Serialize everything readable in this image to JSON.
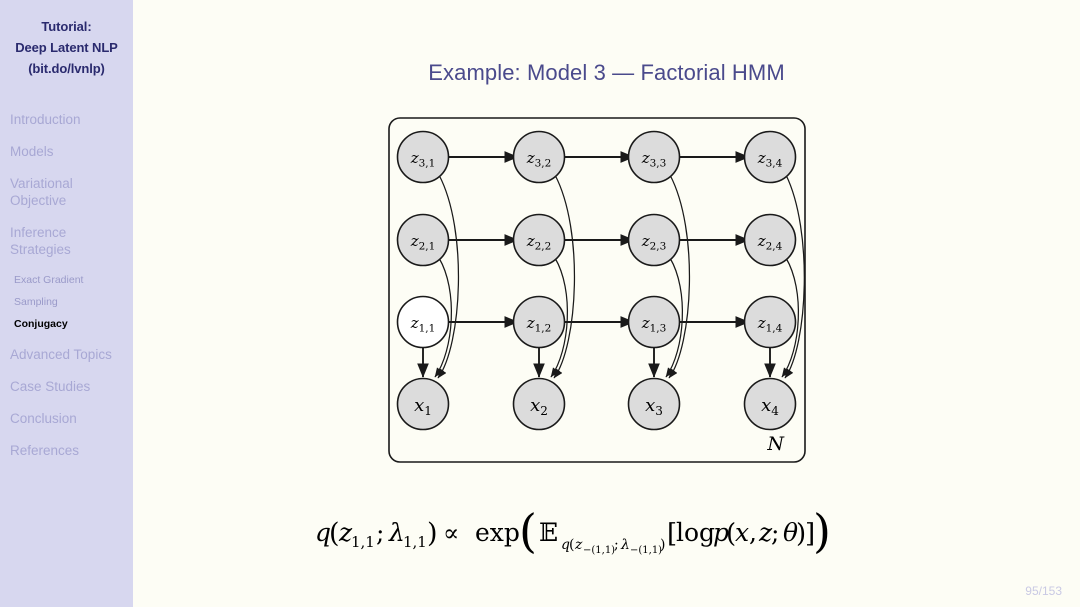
{
  "sidebar": {
    "header_lines": [
      "Tutorial:",
      "Deep Latent NLP",
      "(bit.do/lvnlp)"
    ],
    "sections": [
      {
        "label": "Introduction",
        "active": false
      },
      {
        "label": "Models",
        "active": false
      },
      {
        "label": "Variational Objective",
        "active": false
      },
      {
        "label": "Inference Strategies",
        "active": false
      },
      {
        "label": "Advanced Topics",
        "active": false
      },
      {
        "label": "Case Studies",
        "active": false
      },
      {
        "label": "Conclusion",
        "active": false
      },
      {
        "label": "References",
        "active": false
      }
    ],
    "subsections": [
      {
        "label": "Exact Gradient",
        "active": false
      },
      {
        "label": "Sampling",
        "active": false
      },
      {
        "label": "Conjugacy",
        "active": true
      }
    ]
  },
  "slide": {
    "title": "Example: Model 3 — Factorial HMM",
    "page_number": "95/153",
    "plate_label": "N"
  },
  "figure": {
    "type": "graphical-model",
    "rows": [
      {
        "name": "z3",
        "nodes": [
          "z3,1",
          "z3,2",
          "z3,3",
          "z3,4"
        ],
        "shaded": [
          true,
          true,
          true,
          true
        ]
      },
      {
        "name": "z2",
        "nodes": [
          "z2,1",
          "z2,2",
          "z2,3",
          "z2,4"
        ],
        "shaded": [
          true,
          true,
          true,
          true
        ]
      },
      {
        "name": "z1",
        "nodes": [
          "z1,1",
          "z1,2",
          "z1,3",
          "z1,4"
        ],
        "shaded": [
          false,
          true,
          true,
          true
        ]
      },
      {
        "name": "x",
        "nodes": [
          "x1",
          "x2",
          "x3",
          "x4"
        ],
        "shaded": [
          true,
          true,
          true,
          true
        ]
      }
    ],
    "node_labels": {
      "z3_1": {
        "base": "z",
        "sub": "3,1"
      },
      "z3_2": {
        "base": "z",
        "sub": "3,2"
      },
      "z3_3": {
        "base": "z",
        "sub": "3,3"
      },
      "z3_4": {
        "base": "z",
        "sub": "3,4"
      },
      "z2_1": {
        "base": "z",
        "sub": "2,1"
      },
      "z2_2": {
        "base": "z",
        "sub": "2,2"
      },
      "z2_3": {
        "base": "z",
        "sub": "2,3"
      },
      "z2_4": {
        "base": "z",
        "sub": "2,4"
      },
      "z1_1": {
        "base": "z",
        "sub": "1,1"
      },
      "z1_2": {
        "base": "z",
        "sub": "1,2"
      },
      "z1_3": {
        "base": "z",
        "sub": "1,3"
      },
      "z1_4": {
        "base": "z",
        "sub": "1,4"
      },
      "x_1": {
        "base": "x",
        "sub": "1"
      },
      "x_2": {
        "base": "x",
        "sub": "2"
      },
      "x_3": {
        "base": "x",
        "sub": "3"
      },
      "x_4": {
        "base": "x",
        "sub": "4"
      }
    },
    "shaded_fill": "#dcdcdc",
    "unshaded_fill": "#ffffff",
    "stroke": "#1a1a1a",
    "description": "Factorial HMM: three parallel latent chains z1,z2,z3 each with horizontal transitions across 4 time steps; all three chains emit into observation node x_t at each time step. Node z1,1 is unshaded (query variable)."
  },
  "formula": {
    "text": "q(z_{1,1}; λ_{1,1}) ∝ exp( E_{q(z_{-(1,1)}; λ_{-(1,1)})} [ log p(x, z; θ) ] )",
    "parts": {
      "q": "q",
      "open": "(",
      "z_base": "z",
      "z_sub": "1,1",
      "semi": ";",
      "lambda": "λ",
      "lambda_sub": "1,1",
      "close": ")",
      "prop": "∝",
      "exp": "exp",
      "E": "E",
      "E_sub": "q(z−(1,1); λ−(1,1))",
      "bracket_open": "[",
      "log": "log",
      "p": "p",
      "p_args": "(x, z; θ)",
      "bracket_close": "]"
    }
  },
  "colors": {
    "sidebar_bg": "#d7d7ef",
    "slide_bg": "#fdfdf5",
    "title": "#4a4a8c",
    "sidebar_header": "#2a2a6e",
    "nav_inactive": "#a8a8d4",
    "nav_active": "#000000",
    "pagenum": "#c9c9e4"
  }
}
